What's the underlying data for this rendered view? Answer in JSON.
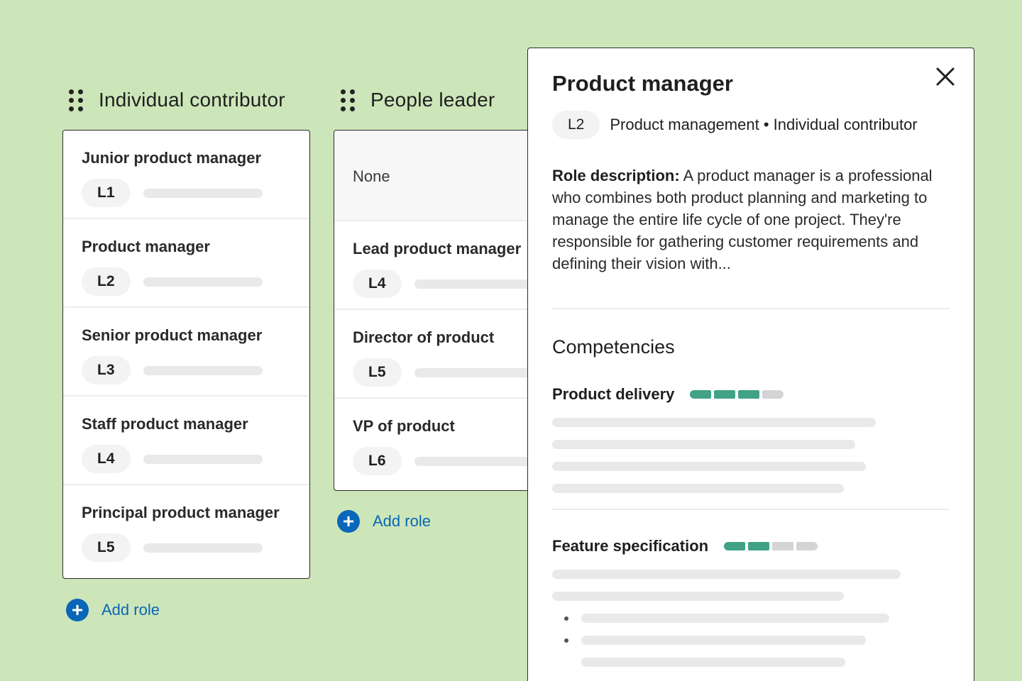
{
  "columns": [
    {
      "title": "Individual contributor",
      "roles": [
        {
          "name": "Junior product manager",
          "level": "L1"
        },
        {
          "name": "Product manager",
          "level": "L2"
        },
        {
          "name": "Senior product manager",
          "level": "L3"
        },
        {
          "name": "Staff product manager",
          "level": "L4"
        },
        {
          "name": "Principal product manager",
          "level": "L5"
        }
      ],
      "add_label": "Add role"
    },
    {
      "title": "People leader",
      "none_label": "None",
      "roles": [
        {
          "name": "Lead product manager",
          "level": "L4"
        },
        {
          "name": "Director of product",
          "level": "L5"
        },
        {
          "name": "VP of product",
          "level": "L6"
        }
      ],
      "add_label": "Add role"
    }
  ],
  "panel": {
    "title": "Product manager",
    "level": "L2",
    "meta": "Product management • Individual contributor",
    "desc_label": "Role description:",
    "desc_text": " A product manager is a professional who combines both product planning and marketing to manage the entire life cycle of one project. They're responsible for gathering customer requirements and defining their vision with...",
    "competencies_title": "Competencies",
    "competencies": [
      {
        "name": "Product delivery",
        "level": 3,
        "max": 4
      },
      {
        "name": "Feature specification",
        "level": 2,
        "max": 4
      }
    ]
  },
  "colors": {
    "background": "#cde6b9",
    "accent_blue": "#0a66b8",
    "meter_on": "#41a286",
    "meter_off": "#d4d4d4"
  },
  "icons": {
    "grip": "grip-dots-icon",
    "add": "plus-circle-icon",
    "close": "close-icon"
  }
}
